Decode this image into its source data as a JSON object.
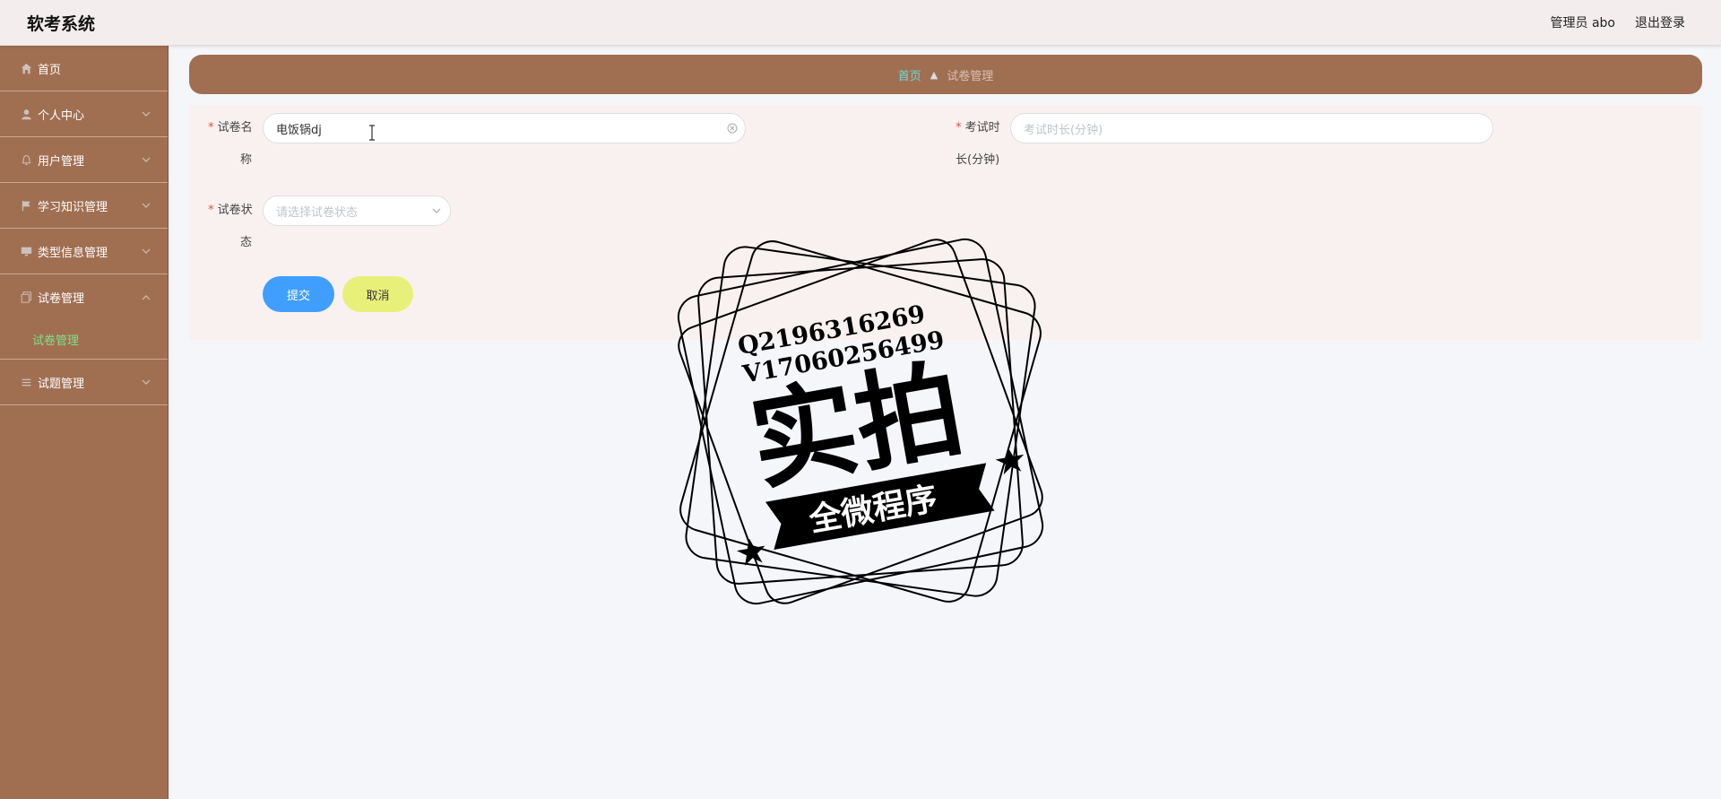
{
  "header": {
    "app_title": "软考系统",
    "user_label": "管理员 abo",
    "logout_label": "退出登录"
  },
  "sidebar": {
    "items": [
      {
        "label": "首页",
        "icon": "home-icon",
        "has_children": false
      },
      {
        "label": "个人中心",
        "icon": "user-icon",
        "has_children": true
      },
      {
        "label": "用户管理",
        "icon": "bell-icon",
        "has_children": true
      },
      {
        "label": "学习知识管理",
        "icon": "flag-icon",
        "has_children": true
      },
      {
        "label": "类型信息管理",
        "icon": "monitor-icon",
        "has_children": true
      },
      {
        "label": "试卷管理",
        "icon": "copy-icon",
        "has_children": true,
        "expanded": true
      },
      {
        "label": "试题管理",
        "icon": "list-icon",
        "has_children": true
      }
    ],
    "active_submenu": "试卷管理"
  },
  "breadcrumb": {
    "home": "首页",
    "current": "试卷管理"
  },
  "form": {
    "paper_name": {
      "label_line1": "试卷名",
      "label_line2": "称",
      "value": "电饭锅dj",
      "required": true
    },
    "duration": {
      "label_line1": "考试时",
      "label_line2": "长(分钟)",
      "placeholder": "考试时长(分钟)",
      "required": true
    },
    "status": {
      "label_line1": "试卷状",
      "label_line2": "态",
      "placeholder": "请选择试卷状态",
      "required": true
    },
    "submit_label": "提交",
    "cancel_label": "取消"
  },
  "watermark": {
    "line1": "Q2196316269",
    "line2": "V17060256499",
    "main": "实拍",
    "ribbon": "全微程序"
  },
  "colors": {
    "sidebar_bg": "#a06f52",
    "submit_blue": "#409eff",
    "cancel_yellow": "#e8f07a",
    "active_green": "#7fe08a",
    "breadcrumb_home": "#6fd9dc"
  }
}
